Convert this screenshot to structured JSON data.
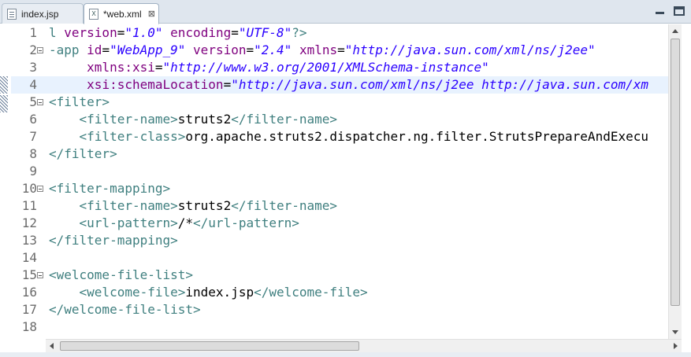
{
  "tabs": [
    {
      "label": "index.jsp",
      "icon": "jsp-file-icon",
      "active": false
    },
    {
      "label": "*web.xml",
      "icon": "xml-file-icon",
      "active": true,
      "close": "⊠"
    }
  ],
  "editor": {
    "current_line": 4,
    "lines": [
      {
        "n": "1",
        "fold": false,
        "segs": [
          [
            "t",
            "l "
          ],
          [
            "a",
            "version"
          ],
          [
            "x",
            "="
          ],
          [
            "v",
            "\"1.0\""
          ],
          [
            "x",
            " "
          ],
          [
            "a",
            "encoding"
          ],
          [
            "x",
            "="
          ],
          [
            "v",
            "\"UTF-8\""
          ],
          [
            "t",
            "?>"
          ]
        ]
      },
      {
        "n": "2",
        "fold": true,
        "segs": [
          [
            "t",
            "-app "
          ],
          [
            "a",
            "id"
          ],
          [
            "x",
            "="
          ],
          [
            "v",
            "\"WebApp_9\""
          ],
          [
            "x",
            " "
          ],
          [
            "a",
            "version"
          ],
          [
            "x",
            "="
          ],
          [
            "v",
            "\"2.4\""
          ],
          [
            "x",
            " "
          ],
          [
            "a",
            "xmlns"
          ],
          [
            "x",
            "="
          ],
          [
            "v",
            "\"http://java.sun.com/xml/ns/j2ee\""
          ]
        ]
      },
      {
        "n": "3",
        "fold": false,
        "segs": [
          [
            "x",
            "     "
          ],
          [
            "a",
            "xmlns:xsi"
          ],
          [
            "x",
            "="
          ],
          [
            "v",
            "\"http://www.w3.org/2001/XMLSchema-instance\""
          ]
        ]
      },
      {
        "n": "4",
        "fold": false,
        "segs": [
          [
            "x",
            "     "
          ],
          [
            "a",
            "xsi:schemaLocation"
          ],
          [
            "x",
            "="
          ],
          [
            "v",
            "\"http://java.sun.com/xml/ns/j2ee http://java.sun.com/xm"
          ]
        ]
      },
      {
        "n": "5",
        "fold": true,
        "segs": [
          [
            "t",
            "<filter>"
          ]
        ]
      },
      {
        "n": "6",
        "fold": false,
        "segs": [
          [
            "x",
            "    "
          ],
          [
            "t",
            "<filter-name>"
          ],
          [
            "x",
            "struts2"
          ],
          [
            "t",
            "</filter-name>"
          ]
        ]
      },
      {
        "n": "7",
        "fold": false,
        "segs": [
          [
            "x",
            "    "
          ],
          [
            "t",
            "<filter-class>"
          ],
          [
            "x",
            "org.apache.struts2.dispatcher.ng.filter.StrutsPrepareAndExecu"
          ]
        ]
      },
      {
        "n": "8",
        "fold": false,
        "segs": [
          [
            "t",
            "</filter>"
          ]
        ]
      },
      {
        "n": "9",
        "fold": false,
        "segs": []
      },
      {
        "n": "10",
        "fold": true,
        "segs": [
          [
            "t",
            "<filter-mapping>"
          ]
        ]
      },
      {
        "n": "11",
        "fold": false,
        "segs": [
          [
            "x",
            "    "
          ],
          [
            "t",
            "<filter-name>"
          ],
          [
            "x",
            "struts2"
          ],
          [
            "t",
            "</filter-name>"
          ]
        ]
      },
      {
        "n": "12",
        "fold": false,
        "segs": [
          [
            "x",
            "    "
          ],
          [
            "t",
            "<url-pattern>"
          ],
          [
            "x",
            "/*"
          ],
          [
            "t",
            "</url-pattern>"
          ]
        ]
      },
      {
        "n": "13",
        "fold": false,
        "segs": [
          [
            "t",
            "</filter-mapping>"
          ]
        ]
      },
      {
        "n": "14",
        "fold": false,
        "segs": []
      },
      {
        "n": "15",
        "fold": true,
        "segs": [
          [
            "t",
            "<welcome-file-list>"
          ]
        ]
      },
      {
        "n": "16",
        "fold": false,
        "segs": [
          [
            "x",
            "    "
          ],
          [
            "t",
            "<welcome-file>"
          ],
          [
            "x",
            "index.jsp"
          ],
          [
            "t",
            "</welcome-file>"
          ]
        ]
      },
      {
        "n": "17",
        "fold": false,
        "segs": [
          [
            "t",
            "</welcome-file-list>"
          ]
        ]
      },
      {
        "n": "18",
        "fold": false,
        "segs": []
      }
    ]
  },
  "window_controls": [
    "minimize-icon",
    "maximize-icon"
  ],
  "colors": {
    "tag": "#3f7f7f",
    "attribute": "#7f007f",
    "value": "#2a00ff",
    "text": "#000000",
    "current_line_bg": "#e8f2fe"
  }
}
